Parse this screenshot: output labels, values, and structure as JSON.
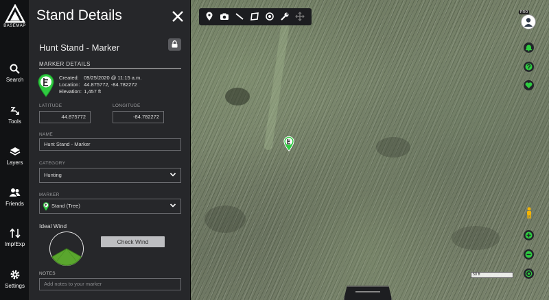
{
  "app": {
    "logo_text": "BASEMAP"
  },
  "nav": [
    {
      "label": "Search",
      "icon": "search-icon"
    },
    {
      "label": "Tools",
      "icon": "tools-icon"
    },
    {
      "label": "Layers",
      "icon": "layers-icon"
    },
    {
      "label": "Friends",
      "icon": "friends-icon"
    },
    {
      "label": "Imp/Exp",
      "icon": "import-export-icon"
    },
    {
      "label": "Settings",
      "icon": "gear-icon"
    }
  ],
  "panel": {
    "title": "Stand Details",
    "stand_name": "Hunt Stand - Marker",
    "section_title": "MARKER DETAILS",
    "meta": {
      "created_label": "Created:",
      "created_value": "09/25/2020 @ 11:15 a.m.",
      "location_label": "Location:",
      "location_value": "44.875772, -84.782272",
      "elevation_label": "Elevation:",
      "elevation_value": "1,457 ft"
    },
    "latitude_label": "LATITUDE",
    "latitude_value": "44.875772",
    "longitude_label": "LONGITUDE",
    "longitude_value": "-84.782272",
    "name_label": "NAME",
    "name_value": "Hunt Stand - Marker",
    "category_label": "CATEGORY",
    "category_value": "Hunting",
    "marker_label": "MARKER",
    "marker_value": "Stand (Tree)",
    "ideal_wind_label": "Ideal Wind",
    "check_wind_label": "Check Wind",
    "notes_label": "NOTES",
    "notes_placeholder": "Add notes to your marker"
  },
  "map": {
    "toolbar_icons": [
      "map-pin-icon",
      "camera-icon",
      "line-icon",
      "polygon-icon",
      "target-icon",
      "wrench-icon",
      "move-icon"
    ],
    "pro_badge": "PRO",
    "scale_label": "50 ft",
    "accent_color": "#2ecc40"
  }
}
